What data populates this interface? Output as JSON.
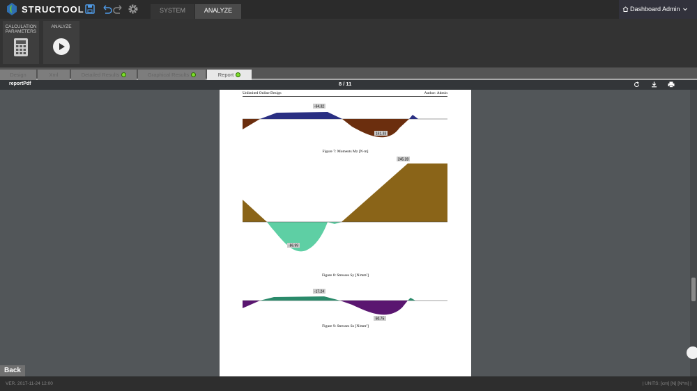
{
  "app": {
    "name": "STRUCTOOL"
  },
  "top_tabs": [
    {
      "label": "SYSTEM"
    },
    {
      "label": "ANALYZE"
    }
  ],
  "user": {
    "dashboard": "Dashboard",
    "admin": "Admin"
  },
  "ribbon": {
    "calc": {
      "label": "CALCULATION PARAMETERS"
    },
    "analyze": {
      "label": "ANALYZE"
    }
  },
  "tabs": [
    {
      "label": "Design"
    },
    {
      "label": "Xml"
    },
    {
      "label": "Detailed Results"
    },
    {
      "label": "Graphical Results"
    },
    {
      "label": "Report"
    }
  ],
  "pdf": {
    "title": "reportPdf",
    "page_indicator": "8  /  11",
    "header_left": "Unlimited Online Design",
    "header_right": "Author: Admin",
    "figures": [
      {
        "caption": "Figure 7: Moments Mz [N·m]",
        "labels": [
          "-64.32",
          "161.33"
        ]
      },
      {
        "caption": "Figure 8: Stresses Sy [N/mm²]",
        "labels": [
          "245.28",
          "-86.99"
        ]
      },
      {
        "caption": "Figure 9: Stresses Sz [N/mm²]",
        "labels": [
          "-17.24",
          "60.75"
        ]
      }
    ]
  },
  "back": {
    "label": "Back"
  },
  "footer": {
    "version": "VER. 2017-11-24 12:00",
    "units": "| UNITS: [cm] [N] [N*m] |"
  },
  "colors": {
    "topbar": "#2b2b2b",
    "ok_dot": "#7cdc2c",
    "fig7_neg": "#2a2f82",
    "fig7_pos": "#6b2e0e",
    "fig8_pos": "#8a6418",
    "fig8_neg": "#5ecfa4",
    "fig9_neg": "#2a8a6a",
    "fig9_pos": "#5a1670"
  },
  "icons": [
    "save-icon",
    "undo-icon",
    "redo-icon",
    "gear-icon",
    "home-icon",
    "chevron-down-icon",
    "calculator-icon",
    "play-icon",
    "refresh-icon",
    "download-icon",
    "print-icon"
  ]
}
